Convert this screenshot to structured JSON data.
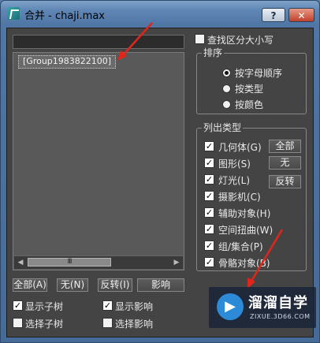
{
  "window": {
    "title": "合并 - chaji.max",
    "help_label": "?",
    "close_label": "✕"
  },
  "search": {
    "value": ""
  },
  "list": {
    "items": [
      "[Group1983822100]"
    ],
    "scroll_thumb_label": "III"
  },
  "list_buttons": {
    "all": "全部(A)",
    "none": "无(N)",
    "invert": "反转(I)",
    "influences": "影响"
  },
  "tree_options": {
    "show_tree": {
      "label": "显示子树",
      "checked": true
    },
    "select_tree": {
      "label": "选择子树",
      "checked": false
    },
    "show_influences": {
      "label": "显示影响",
      "checked": true
    },
    "select_influences": {
      "label": "选择影响",
      "checked": false
    }
  },
  "case_sensitive": {
    "label": "查找区分大小写",
    "checked": false
  },
  "sort": {
    "title": "排序",
    "options": [
      {
        "label": "按字母顺序",
        "selected": true
      },
      {
        "label": "按类型",
        "selected": false
      },
      {
        "label": "按颜色",
        "selected": false
      }
    ]
  },
  "list_types": {
    "title": "列出类型",
    "items": [
      {
        "label": "几何体(G)",
        "checked": true
      },
      {
        "label": "图形(S)",
        "checked": true
      },
      {
        "label": "灯光(L)",
        "checked": true
      },
      {
        "label": "摄影机(C)",
        "checked": true
      },
      {
        "label": "辅助对象(H)",
        "checked": true
      },
      {
        "label": "空间扭曲(W)",
        "checked": true
      },
      {
        "label": "组/集合(P)",
        "checked": true
      },
      {
        "label": "骨骼对象(B)",
        "checked": true
      }
    ],
    "buttons": {
      "all": "全部",
      "none": "无",
      "invert": "反转"
    }
  },
  "watermark": {
    "title": "溜溜自学",
    "url": "ZIXUE.3D66.COM"
  },
  "colors": {
    "arrow": "#e0261b",
    "client_bg": "#444444",
    "title_bar": "#5f86b4"
  }
}
